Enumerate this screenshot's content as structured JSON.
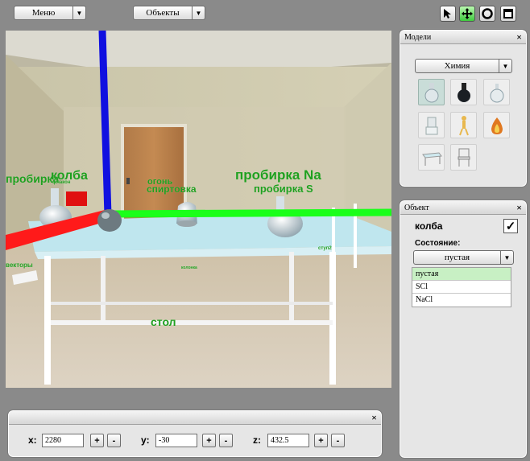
{
  "toolbar": {
    "menu_label": "Меню",
    "objects_label": "Объекты"
  },
  "scene": {
    "labels": {
      "probirka_left": "пробирка",
      "kolba": "колба",
      "flask_small": "флакон",
      "fire": "огонь",
      "spirtovka": "спиртовка",
      "probirka_na": "пробирка Na",
      "probirka_s": "пробирка S",
      "vektory": "векторы",
      "stol": "стол",
      "stup": "ступ2",
      "small_center": "колонка"
    }
  },
  "models_panel": {
    "title": "Модели",
    "category": "Химия",
    "thumbnails": [
      "flask-model",
      "black-flask-model",
      "round-flask-model",
      "burner-model",
      "figure-model",
      "fire-model",
      "table-model",
      "chair-model"
    ]
  },
  "object_panel": {
    "title": "Объект",
    "object_name": "колба",
    "checkbox_mark": "✓",
    "state_label": "Состояние:",
    "state_selected": "пустая",
    "states": [
      "пустая",
      "SCl",
      "NaCl"
    ]
  },
  "coords": {
    "x_label": "x:",
    "x_value": "2280",
    "y_label": "y:",
    "y_value": "-30",
    "z_label": "z:",
    "z_value": "432.5",
    "plus": "+",
    "minus": "-"
  },
  "colors": {
    "axis_x": "#ff1a1a",
    "axis_y": "#1aff1a",
    "axis_z": "#1010e0",
    "label_green": "#1fa01f",
    "row_active": "#c8f0c4"
  }
}
